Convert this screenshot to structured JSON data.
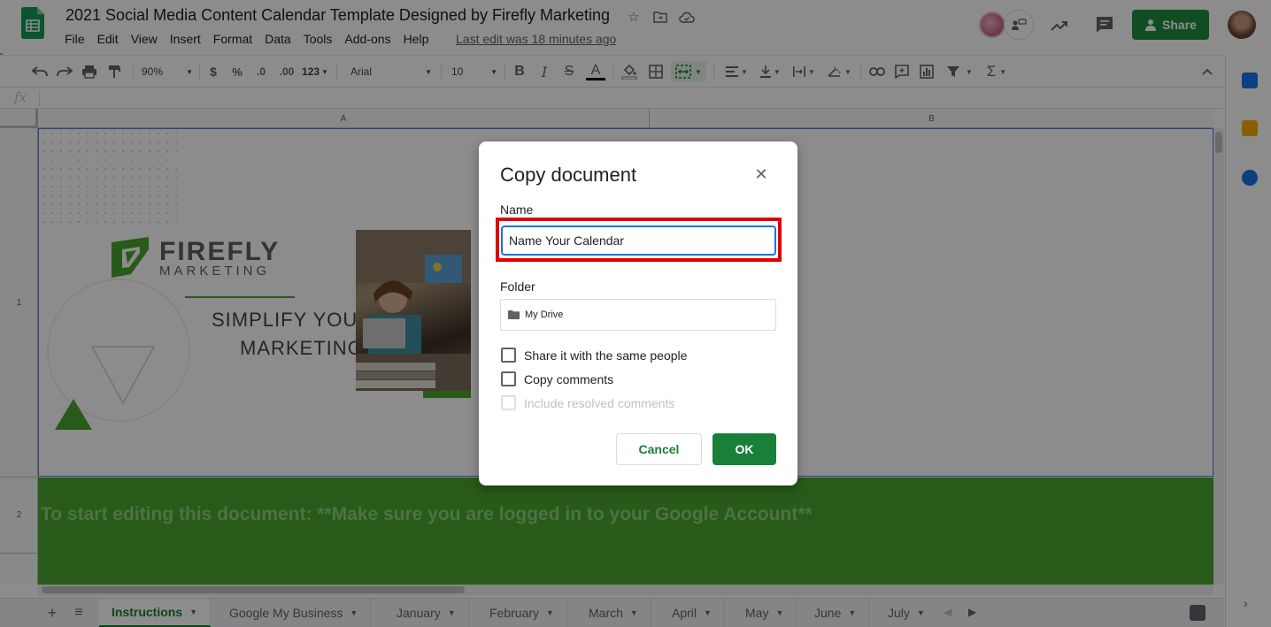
{
  "app": {
    "doc_title": "2021 Social Media Content Calendar Template Designed by Firefly Marketing",
    "last_edit": "Last edit was 18 minutes ago",
    "share_label": "Share",
    "menu": [
      "File",
      "Edit",
      "View",
      "Insert",
      "Format",
      "Data",
      "Tools",
      "Add-ons",
      "Help"
    ]
  },
  "toolbar": {
    "zoom": "90%",
    "currency": "$",
    "percent": "%",
    "decrease_decimal": ".0",
    "increase_decimal": ".00",
    "more_formats": "123",
    "font": "Arial",
    "font_size": "10",
    "bold": "B",
    "italic": "I",
    "strike": "S",
    "text_color": "A"
  },
  "formula_bar": {
    "label": "fx"
  },
  "grid": {
    "columns": [
      "A",
      "B"
    ],
    "rows": [
      "1",
      "2"
    ],
    "brand": {
      "name": "FIREFLY",
      "sub": "MARKETING",
      "slogan_line1": "SIMPLIFY YOUR",
      "slogan_line2": "MARKETING"
    },
    "row2_text": "To start editing this document: **Make sure you are logged in to your Google Account**"
  },
  "dialog": {
    "title": "Copy document",
    "name_label": "Name",
    "name_value": "Name Your Calendar",
    "folder_label": "Folder",
    "folder_value": "My Drive",
    "share_same_people": "Share it with the same people",
    "copy_comments": "Copy comments",
    "include_resolved": "Include resolved comments",
    "cancel_label": "Cancel",
    "ok_label": "OK"
  },
  "sheet_tabs": [
    "Instructions",
    "Google My Business",
    "January",
    "February",
    "March",
    "April",
    "May",
    "June",
    "July"
  ],
  "active_tab": "Instructions",
  "colors": {
    "brand_green": "#188038",
    "share_green": "#1e8e3e",
    "row_green": "#4aa52e",
    "highlight_red": "#e00000",
    "focus_blue": "#1a73e8"
  }
}
